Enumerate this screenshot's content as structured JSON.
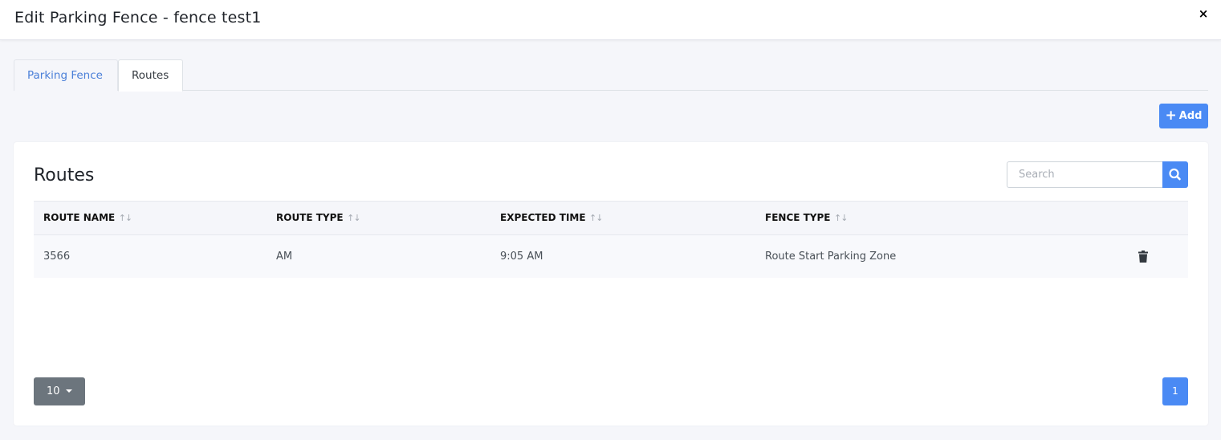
{
  "modal": {
    "title": "Edit Parking Fence - fence test1",
    "close_label": "×"
  },
  "tabs": [
    {
      "label": "Parking Fence",
      "active": false
    },
    {
      "label": "Routes",
      "active": true
    }
  ],
  "toolbar": {
    "add_label": "Add",
    "add_icon": "plus-icon"
  },
  "routes": {
    "title": "Routes",
    "search": {
      "placeholder": "Search",
      "value": "",
      "icon": "search-icon"
    },
    "columns": [
      "ROUTE NAME",
      "ROUTE TYPE",
      "EXPECTED TIME",
      "FENCE TYPE"
    ],
    "rows": [
      {
        "route_name": "3566",
        "route_type": "AM",
        "expected_time": "9:05 AM",
        "fence_type": "Route Start Parking Zone",
        "action_icon": "trash-icon"
      }
    ],
    "page_size": "10",
    "pages": [
      "1"
    ],
    "current_page": "1"
  },
  "colors": {
    "primary": "#4a8af4",
    "tab_link": "#4a7fd8",
    "secondary": "#6c757d",
    "background": "#f5f6fa"
  }
}
